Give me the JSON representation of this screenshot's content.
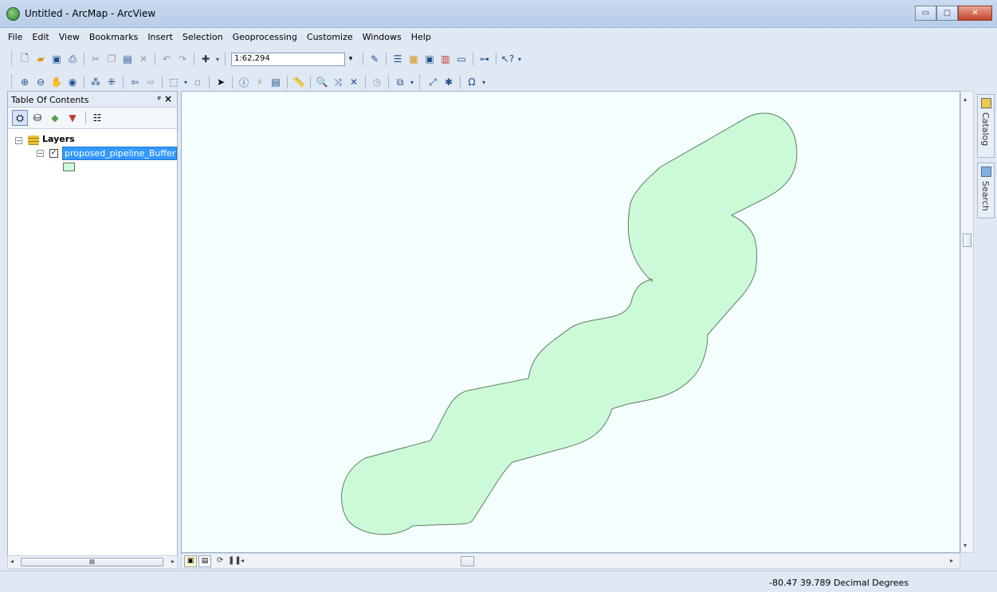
{
  "window": {
    "title": "Untitled - ArcMap - ArcView",
    "controls": {
      "minimize": "▭",
      "maximize": "▢",
      "close": "✕"
    }
  },
  "menubar": {
    "items": [
      "File",
      "Edit",
      "View",
      "Bookmarks",
      "Insert",
      "Selection",
      "Geoprocessing",
      "Customize",
      "Windows",
      "Help"
    ]
  },
  "toolbar": {
    "scale": "1:62,294",
    "scale_dropdown": "▾"
  },
  "toc": {
    "title": "Table Of Contents",
    "pin": "ᵠ",
    "close": "×",
    "root_label": "Layers",
    "layer": {
      "name": "proposed_pipeline_Buffer",
      "checked": true,
      "symbol_color": "#ccfad8"
    },
    "hscroll_grip": "III"
  },
  "map": {
    "background_color": "#f5fefe",
    "buffer_fill_color": "#ccfad8",
    "buffer_stroke_color": "#5e7e62"
  },
  "dock": {
    "catalog_label": "Catalog",
    "search_label": "Search"
  },
  "status": {
    "coordinates": "-80.47  39.789 Decimal Degrees"
  }
}
